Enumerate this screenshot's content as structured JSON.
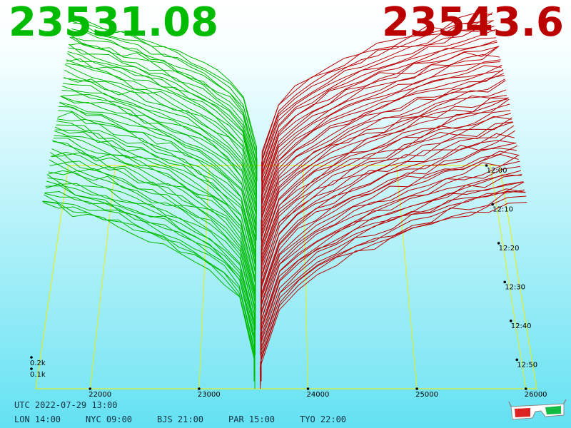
{
  "header": {
    "bid_price": "23531.08",
    "ask_price": "23543.6",
    "bid_color": "#00bb00",
    "ask_color": "#bb0000"
  },
  "footer": {
    "utc_label": "UTC 2022-07-29 13:00",
    "timezones": [
      {
        "label": "LON 14:00"
      },
      {
        "label": "NYC 09:00"
      },
      {
        "label": "BJS 21:00"
      },
      {
        "label": "PAR 15:00"
      },
      {
        "label": "TYO 22:00"
      }
    ],
    "glasses_icon": "3d-glasses-icon"
  },
  "chart_data": {
    "type": "area",
    "x_ticks": [
      {
        "value": 22000,
        "label": "22000"
      },
      {
        "value": 23000,
        "label": "23000"
      },
      {
        "value": 24000,
        "label": "24000"
      },
      {
        "value": 25000,
        "label": "25000"
      },
      {
        "value": 26000,
        "label": "26000"
      }
    ],
    "time_ticks": [
      {
        "label": "12:00"
      },
      {
        "label": "12:10"
      },
      {
        "label": "12:20"
      },
      {
        "label": "12:30"
      },
      {
        "label": "12:40"
      },
      {
        "label": "12:50"
      }
    ],
    "volume_ticks": [
      {
        "value": 0.1,
        "label": "0.1k"
      },
      {
        "value": 0.2,
        "label": "0.2k"
      }
    ],
    "xlim": [
      21500,
      26100
    ],
    "mid_price": 23537,
    "bid_color": "#00bb00",
    "ask_color": "#bb0000",
    "grid_color": "#eeee00",
    "snapshots": 60,
    "bid_depth_max": 0.83,
    "ask_depth_max": 0.86
  }
}
